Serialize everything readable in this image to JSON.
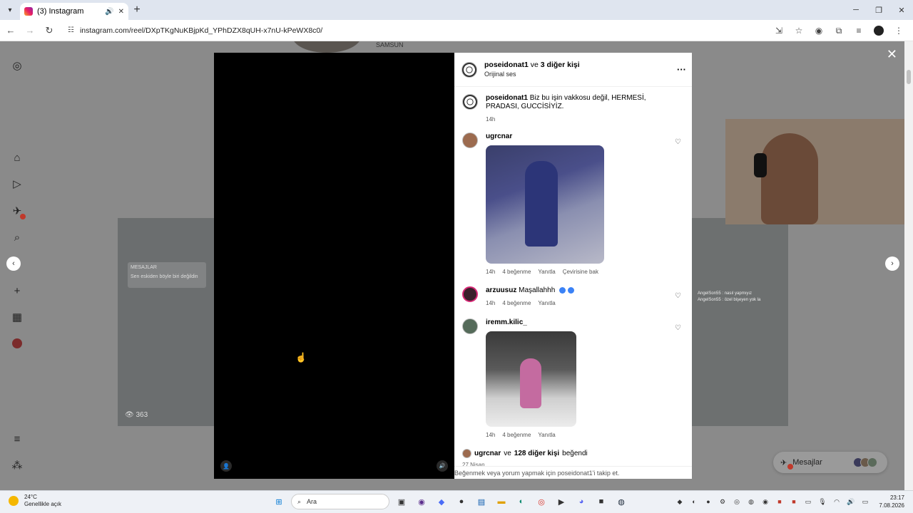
{
  "browser": {
    "tab_title": "(3) Instagram",
    "url": "instagram.com/reel/DXpTKgNuKBjpKd_YPhDZX8qUH-x7nU-kPeWX8c0/"
  },
  "background": {
    "top_text": "SAMSUN",
    "left_thumb_views": "363",
    "left_thumb_msg_title": "MESAJLAR",
    "left_thumb_msg_text": "Sen eskiden böyle biri değildin",
    "right_thumb_chat_1": "AngelSon55 : nasıl yapmıyız",
    "right_thumb_chat_2": "AngelSon55 : özel bişeyen yok la"
  },
  "post": {
    "author": "poseidonat1",
    "coauthors_text": "ve",
    "coauthors_link": "3 diğer kişi",
    "audio": "Orijinal ses"
  },
  "comments": [
    {
      "user": "poseidonat1",
      "text": "Biz bu işin vakkosu değil, HERMESİ, PRADASI, GUCCİSİYİZ.",
      "time": "14h"
    },
    {
      "user": "ugrcnar",
      "time": "14h",
      "likes": "4 beğenme",
      "reply": "Yanıtla",
      "translate": "Çevirisine bak"
    },
    {
      "user": "arzuusuz",
      "text": "Maşallahhh",
      "time": "14h",
      "likes": "4 beğenme",
      "reply": "Yanıtla"
    },
    {
      "user": "iremm.kilic_",
      "time": "14h",
      "likes": "4 beğenme",
      "reply": "Yanıtla"
    }
  ],
  "likes": {
    "user": "ugrcnar",
    "joiner": "ve",
    "others": "128 diğer kişi",
    "suffix": "beğendi"
  },
  "date": "27 Nisan",
  "login_prompt": "Beğenmek veya yorum yapmak için poseidonat1'i takip et.",
  "messages_label": "Mesajlar",
  "taskbar": {
    "temp": "24°C",
    "weather": "Genellikle açık",
    "search_placeholder": "Ara",
    "time": "23:17",
    "date": "7.08.2026"
  },
  "colors": {
    "brand_badge": "#c0392b",
    "page_overlay": "#8a8a8a"
  }
}
